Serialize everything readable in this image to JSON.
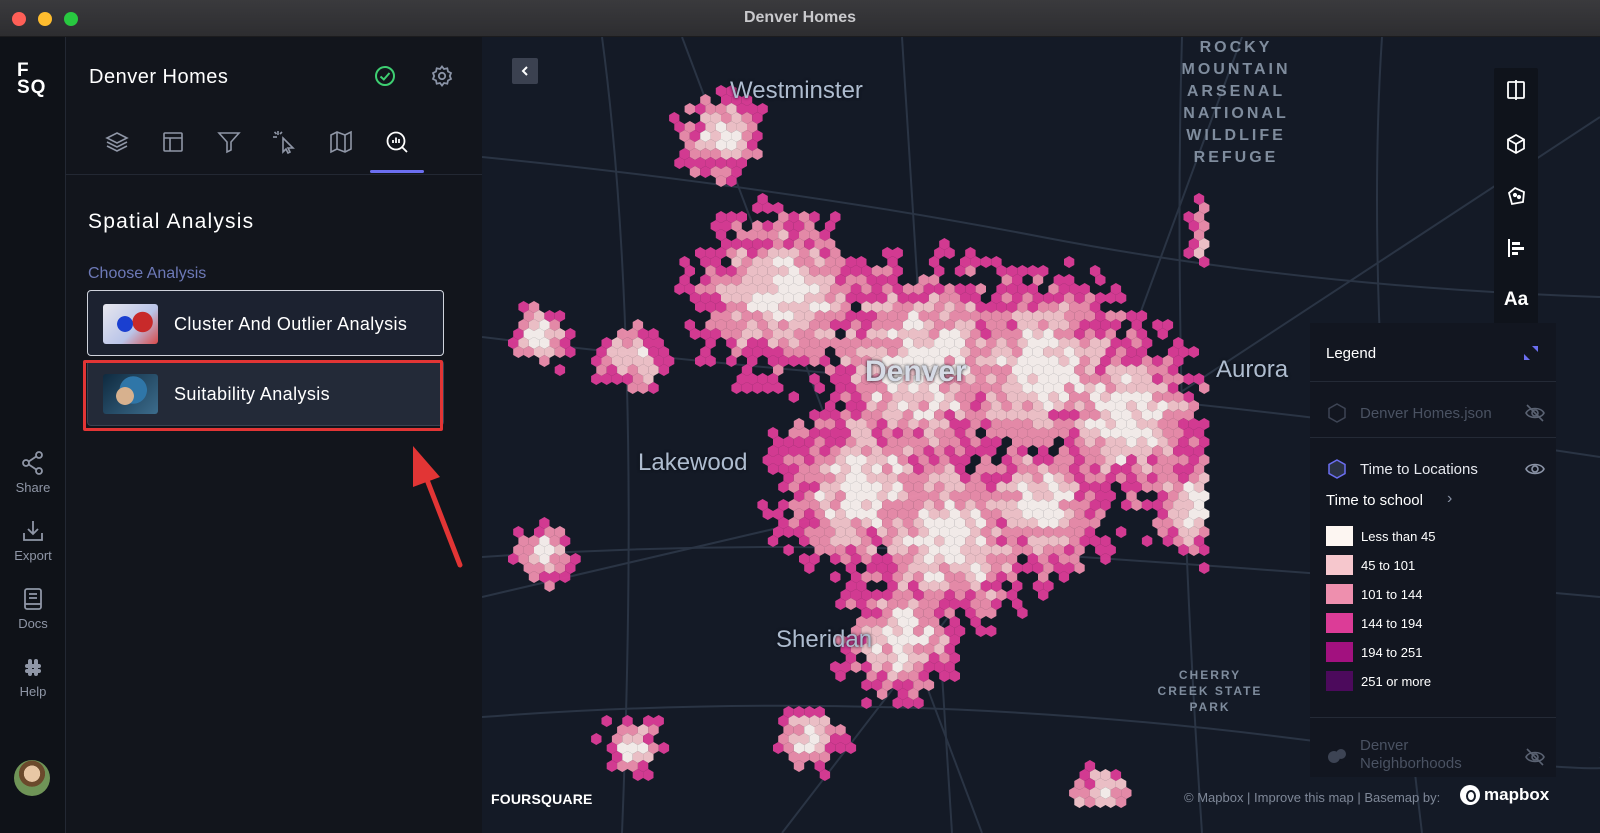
{
  "window": {
    "title": "Denver Homes"
  },
  "rail": {
    "logo_line1": "F",
    "logo_line2": "SQ",
    "items": [
      {
        "label": "Share",
        "icon": "share-icon"
      },
      {
        "label": "Export",
        "icon": "export-icon"
      },
      {
        "label": "Docs",
        "icon": "docs-icon"
      },
      {
        "label": "Help",
        "icon": "help-icon"
      }
    ]
  },
  "panel": {
    "title": "Denver Homes",
    "tabs": [
      "layers-icon",
      "layout-icon",
      "filter-icon",
      "interactions-icon",
      "basemap-icon",
      "analysis-icon"
    ],
    "active_tab": "analysis-icon",
    "section_title": "Spatial Analysis",
    "choose_label": "Choose Analysis",
    "options": [
      {
        "label": "Cluster And Outlier Analysis"
      },
      {
        "label": "Suitability Analysis",
        "highlighted": true
      }
    ]
  },
  "map": {
    "cities": [
      "Westminster",
      "Denver",
      "Aurora",
      "Lakewood",
      "Sheridan"
    ],
    "parks": {
      "rocky": [
        "ROCKY",
        "MOUNTAIN",
        "ARSENAL",
        "NATIONAL",
        "WILDLIFE",
        "REFUGE"
      ],
      "cherry": [
        "CHERRY",
        "CREEK STATE",
        "PARK"
      ]
    },
    "toolbar": [
      "split-map-icon",
      "3d-cube-icon",
      "draw-icon",
      "legend-icon"
    ],
    "toolbar_text": "Aa",
    "attribution_left": "FOURSQUARE",
    "attribution_right": "© Mapbox | Improve this map | Basemap by:",
    "mapbox_label": "mapbox"
  },
  "legend": {
    "title": "Legend",
    "layers": [
      {
        "name": "Denver Homes.json",
        "visible": false
      },
      {
        "name": "Time to Locations",
        "visible": true
      },
      {
        "name": "Denver Neighborhoods",
        "visible": false
      }
    ],
    "field": "Time to school",
    "items": [
      {
        "label": "Less than 45",
        "color": "#fdf6f2"
      },
      {
        "label": "45 to 101",
        "color": "#f6c7cd"
      },
      {
        "label": "101 to 144",
        "color": "#ee8fae"
      },
      {
        "label": "144 to 194",
        "color": "#dc3c97"
      },
      {
        "label": "194 to 251",
        "color": "#a2117f"
      },
      {
        "label": "251 or more",
        "color": "#4c0a5c"
      }
    ]
  },
  "colors": {
    "accent": "#6b6ef0",
    "highlight": "#e23535",
    "ok": "#3ecf72"
  }
}
